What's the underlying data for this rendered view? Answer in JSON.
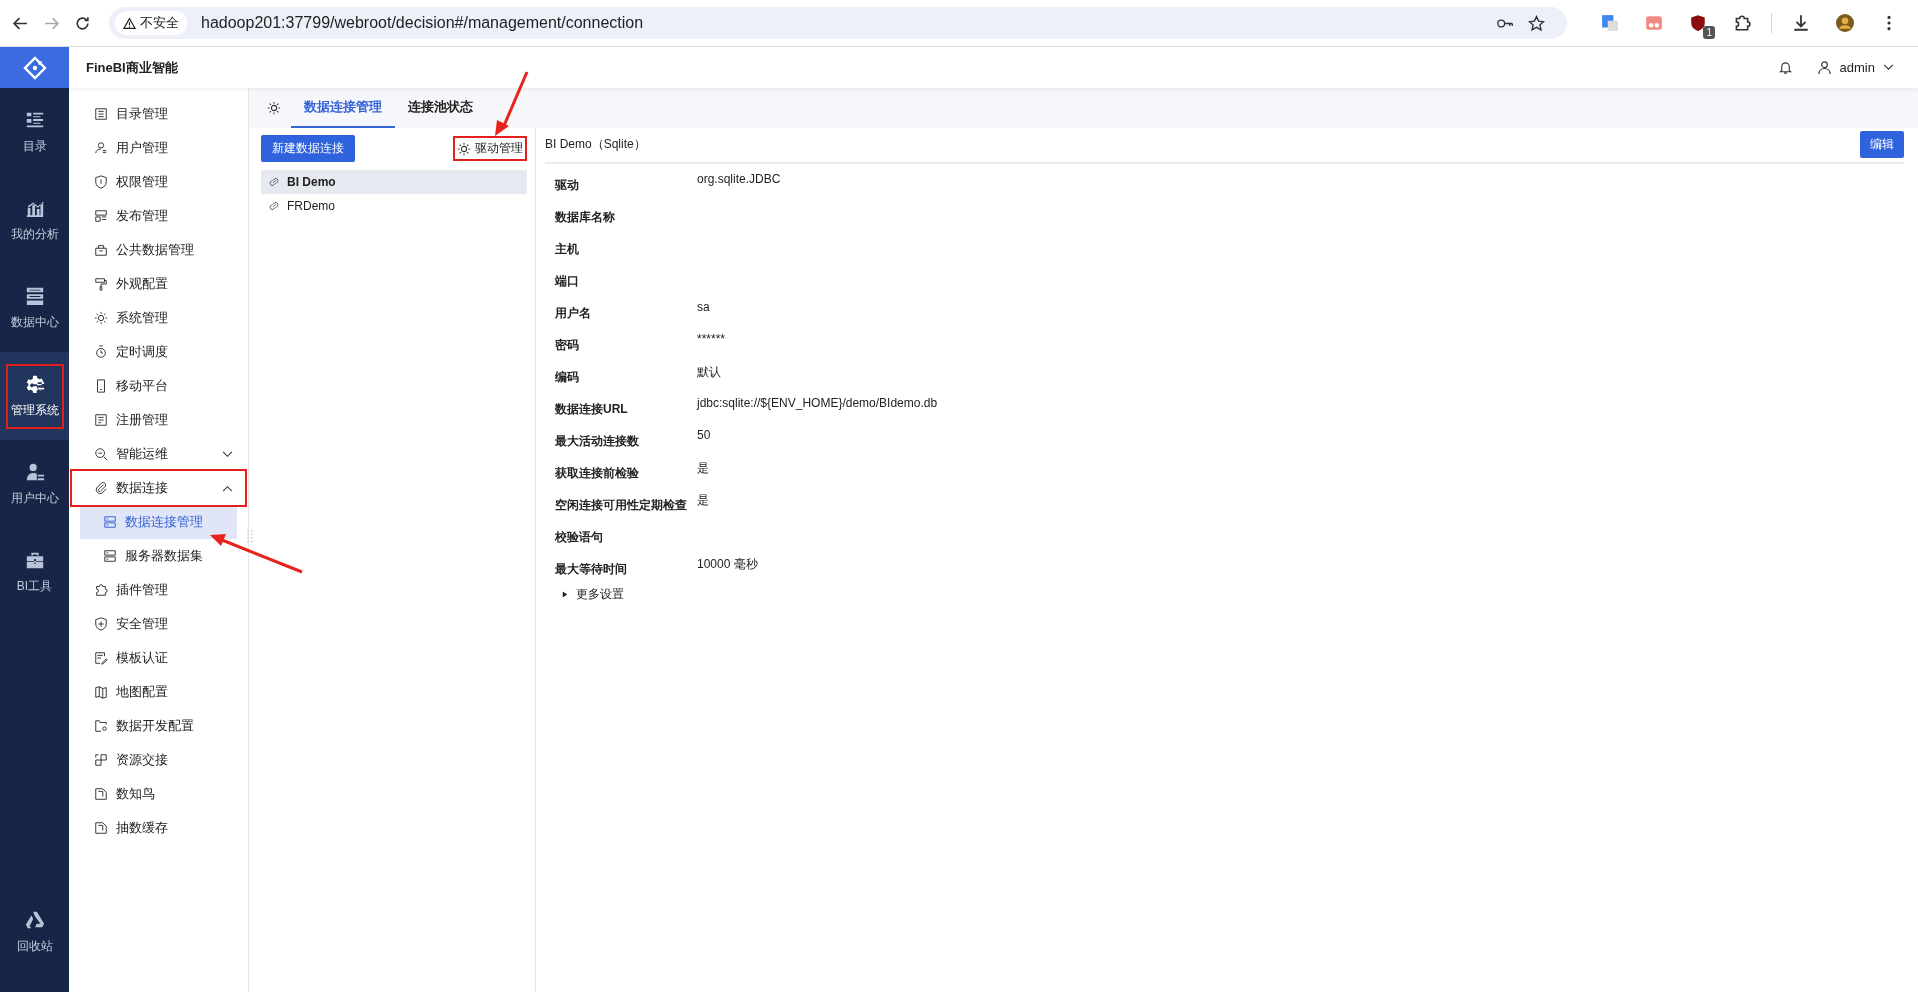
{
  "browser": {
    "security": "不安全",
    "url": "hadoop201:37799/webroot/decision#/management/connection",
    "badge": "1"
  },
  "app": {
    "title": "FineBI商业智能",
    "user": "admin"
  },
  "nav": [
    {
      "label": "目录",
      "selected": false,
      "annotated": false
    },
    {
      "label": "我的分析",
      "selected": false,
      "annotated": false
    },
    {
      "label": "数据中心",
      "selected": false,
      "annotated": false
    },
    {
      "label": "管理系统",
      "selected": true,
      "annotated": true
    },
    {
      "label": "用户中心",
      "selected": false,
      "annotated": false
    },
    {
      "label": "BI工具",
      "selected": false,
      "annotated": false
    }
  ],
  "recycle": {
    "label": "回收站"
  },
  "sidebar": [
    {
      "label": "目录管理",
      "selected": false,
      "annotated": false
    },
    {
      "label": "用户管理",
      "selected": false,
      "annotated": false
    },
    {
      "label": "权限管理",
      "selected": false,
      "annotated": false
    },
    {
      "label": "发布管理",
      "selected": false,
      "annotated": false
    },
    {
      "label": "公共数据管理",
      "selected": false,
      "annotated": false
    },
    {
      "label": "外观配置",
      "selected": false,
      "annotated": false
    },
    {
      "label": "系统管理",
      "selected": false,
      "annotated": false
    },
    {
      "label": "定时调度",
      "selected": false,
      "annotated": false
    },
    {
      "label": "移动平台",
      "selected": false,
      "annotated": false
    },
    {
      "label": "注册管理",
      "selected": false,
      "annotated": false
    },
    {
      "label": "智能运维",
      "selected": false,
      "annotated": false,
      "expanded": false
    },
    {
      "label": "数据连接",
      "selected": false,
      "annotated": true,
      "expanded": true,
      "children": [
        {
          "label": "数据连接管理",
          "selected": true,
          "annotated": false
        },
        {
          "label": "服务器数据集",
          "selected": false,
          "annotated": false
        }
      ]
    },
    {
      "label": "插件管理",
      "selected": false,
      "annotated": false
    },
    {
      "label": "安全管理",
      "selected": false,
      "annotated": false
    },
    {
      "label": "模板认证",
      "selected": false,
      "annotated": false
    },
    {
      "label": "地图配置",
      "selected": false,
      "annotated": false
    },
    {
      "label": "数据开发配置",
      "selected": false,
      "annotated": false
    },
    {
      "label": "资源交接",
      "selected": false,
      "annotated": false
    },
    {
      "label": "数知鸟",
      "selected": false,
      "annotated": false
    },
    {
      "label": "抽数缓存",
      "selected": false,
      "annotated": false
    }
  ],
  "tabs": [
    {
      "label": "数据连接管理",
      "selected": true
    },
    {
      "label": "连接池状态",
      "selected": false
    }
  ],
  "connections_panel": {
    "new_button": "新建数据连接",
    "driver_button": {
      "label": "驱动管理",
      "annotated": true
    },
    "items": [
      {
        "name": "BI Demo",
        "selected": true
      },
      {
        "name": "FRDemo",
        "selected": false
      }
    ]
  },
  "detail": {
    "title": "BI Demo（Sqlite）",
    "edit_button": "编辑",
    "fields": [
      {
        "label": "驱动",
        "value": "org.sqlite.JDBC"
      },
      {
        "label": "数据库名称"
      },
      {
        "label": "主机"
      },
      {
        "label": "端口"
      },
      {
        "label": "用户名",
        "value": "sa"
      },
      {
        "label": "密码",
        "value": "******"
      },
      {
        "label": "编码",
        "value": "默认"
      },
      {
        "label": "数据连接URL",
        "value": "jdbc:sqlite://${ENV_HOME}/demo/BIdemo.db"
      },
      {
        "label": "最大活动连接数",
        "value": "50"
      },
      {
        "label": "获取连接前检验",
        "value": "是"
      },
      {
        "label": "空闲连接可用性定期检查",
        "value": "是"
      },
      {
        "label": "校验语句"
      },
      {
        "label": "最大等待时间",
        "value": "10000 毫秒"
      }
    ],
    "more": {
      "label": "更多设置",
      "expanded": false
    }
  }
}
